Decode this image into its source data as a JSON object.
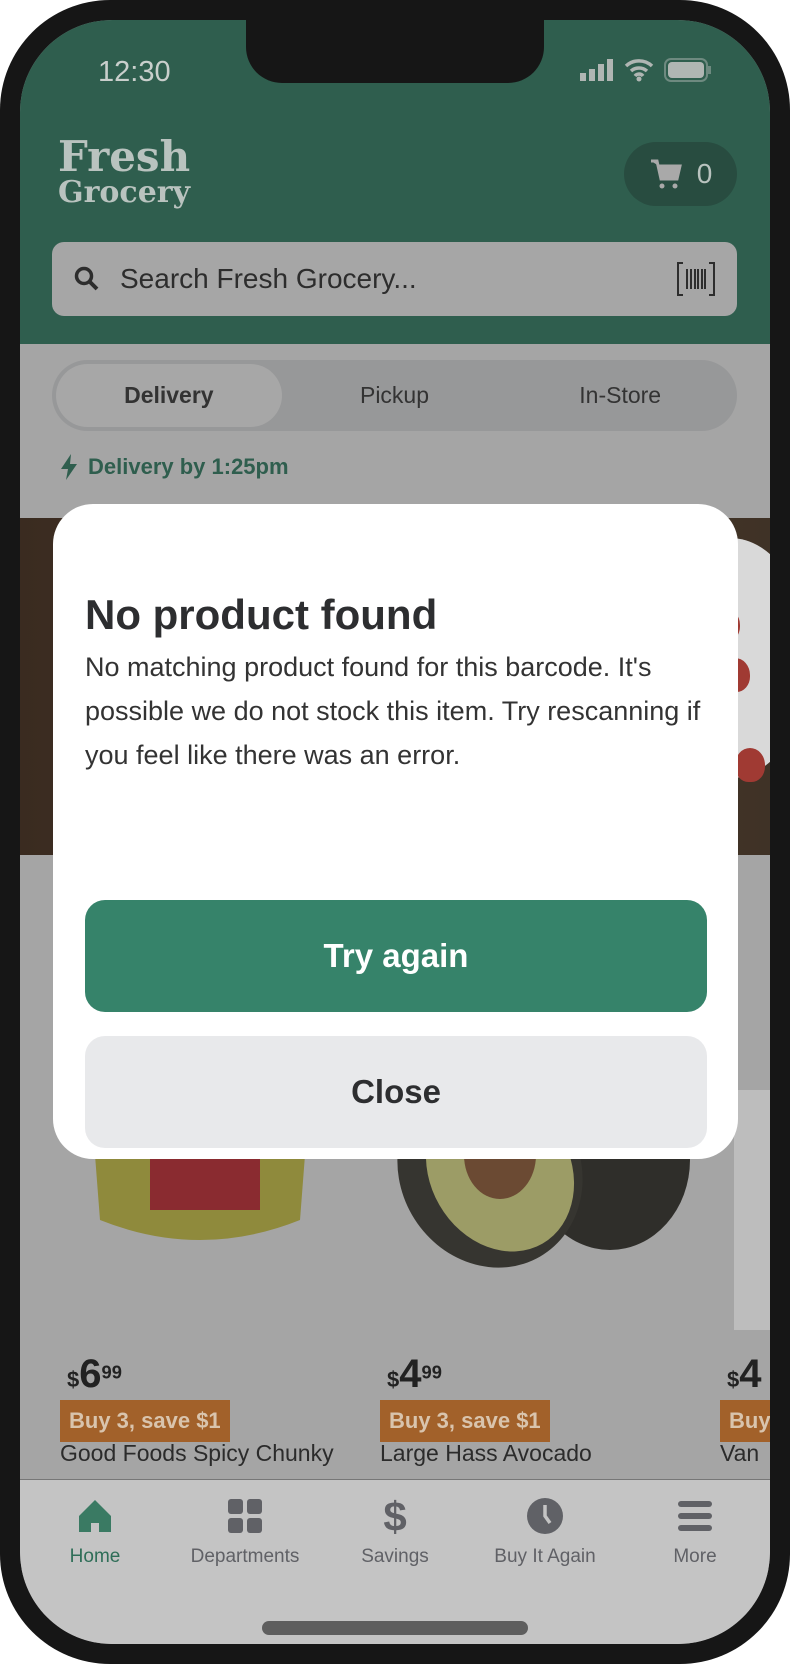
{
  "status_bar": {
    "time": "12:30"
  },
  "header": {
    "logo_line1": "Fresh",
    "logo_line2": "Grocery",
    "cart_count": "0",
    "search_placeholder": "Search Fresh Grocery..."
  },
  "mode_tabs": [
    {
      "label": "Delivery",
      "selected": true
    },
    {
      "label": "Pickup",
      "selected": false
    },
    {
      "label": "In-Store",
      "selected": false
    }
  ],
  "delivery_eta": "Delivery by 1:25pm",
  "products": [
    {
      "dollars": "6",
      "cents": "99",
      "promo": "Buy 3, save $1",
      "name": "Good Foods Spicy Chunky"
    },
    {
      "dollars": "4",
      "cents": "99",
      "promo": "Buy 3, save $1",
      "name": "Large Hass Avocado"
    },
    {
      "dollars": "4",
      "cents": "",
      "promo": "Buy",
      "name": "Van"
    }
  ],
  "nav": [
    {
      "label": "Home",
      "icon": "home-icon",
      "active": true
    },
    {
      "label": "Departments",
      "icon": "grid-icon"
    },
    {
      "label": "Savings",
      "icon": "dollar-icon"
    },
    {
      "label": "Buy It Again",
      "icon": "clock-icon"
    },
    {
      "label": "More",
      "icon": "menu-icon"
    }
  ],
  "modal": {
    "title": "No product found",
    "body": "No matching product found for this barcode. It's possible we do not stock this item. Try rescanning if you feel like there was an error.",
    "primary": "Try again",
    "secondary": "Close"
  },
  "colors": {
    "brand_green": "#36836a",
    "promo": "#a2612a"
  }
}
